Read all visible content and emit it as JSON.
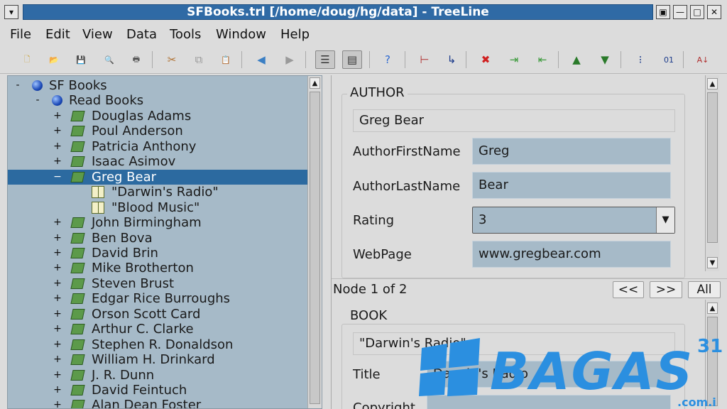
{
  "window": {
    "title": "SFBooks.trl [/home/doug/hg/data] - TreeLine",
    "controls": [
      "▣",
      "—",
      "□",
      "✕"
    ]
  },
  "menu": [
    "File",
    "Edit",
    "View",
    "Data",
    "Tools",
    "Window",
    "Help"
  ],
  "toolbar": [
    {
      "name": "new-file-icon",
      "glyph": "🗋",
      "color": "#caa23a"
    },
    {
      "name": "open-file-icon",
      "glyph": "📂",
      "color": "#3b7fc4"
    },
    {
      "name": "save-icon",
      "glyph": "💾",
      "color": "#8a8a8a"
    },
    {
      "name": "print-preview-icon",
      "glyph": "🔍",
      "color": "#3b7fc4"
    },
    {
      "name": "print-icon",
      "glyph": "🖶",
      "color": "#555"
    },
    {
      "name": "cut-icon",
      "glyph": "✂",
      "color": "#b07030"
    },
    {
      "name": "copy-icon",
      "glyph": "⧉",
      "color": "#999"
    },
    {
      "name": "paste-icon",
      "glyph": "📋",
      "color": "#c9a13a"
    },
    {
      "name": "back-icon",
      "glyph": "◀",
      "color": "#3b7fc4"
    },
    {
      "name": "forward-icon",
      "glyph": "▶",
      "color": "#9a9a9a"
    },
    {
      "name": "data-editor-view-icon",
      "glyph": "☰",
      "color": "#333"
    },
    {
      "name": "title-list-view-icon",
      "glyph": "▤",
      "color": "#333"
    },
    {
      "name": "help-icon",
      "glyph": "?",
      "color": "#2f6ad0"
    },
    {
      "name": "add-child-icon",
      "glyph": "⊢",
      "color": "#b03030"
    },
    {
      "name": "insert-after-icon",
      "glyph": "↳",
      "color": "#1b3a8a"
    },
    {
      "name": "delete-node-icon",
      "glyph": "✖",
      "color": "#d02020"
    },
    {
      "name": "indent-icon",
      "glyph": "⇥",
      "color": "#3a9a3a"
    },
    {
      "name": "unindent-icon",
      "glyph": "⇤",
      "color": "#3a9a3a"
    },
    {
      "name": "move-up-icon",
      "glyph": "▲",
      "color": "#2a7a2a"
    },
    {
      "name": "move-down-icon",
      "glyph": "▼",
      "color": "#2a7a2a"
    },
    {
      "name": "numbering-icon",
      "glyph": "⁝",
      "color": "#1b3a8a"
    },
    {
      "name": "binary-icon",
      "glyph": "01",
      "color": "#1b3a8a"
    },
    {
      "name": "sort-icon",
      "glyph": "A↓",
      "color": "#b03030"
    }
  ],
  "tree": [
    {
      "label": "SF Books",
      "indent": 0,
      "exp": "-",
      "icon": "ball"
    },
    {
      "label": "Read Books",
      "indent": 1,
      "exp": "-",
      "icon": "ball"
    },
    {
      "label": "Douglas Adams",
      "indent": 2,
      "exp": "+",
      "icon": "book"
    },
    {
      "label": "Poul Anderson",
      "indent": 2,
      "exp": "+",
      "icon": "book"
    },
    {
      "label": "Patricia Anthony",
      "indent": 2,
      "exp": "+",
      "icon": "book"
    },
    {
      "label": "Isaac Asimov",
      "indent": 2,
      "exp": "+",
      "icon": "book"
    },
    {
      "label": "Greg Bear",
      "indent": 2,
      "exp": "−",
      "icon": "book",
      "selected": true
    },
    {
      "label": "\"Darwin's Radio\"",
      "indent": 3,
      "exp": "",
      "icon": "openbook"
    },
    {
      "label": "\"Blood Music\"",
      "indent": 3,
      "exp": "",
      "icon": "openbook"
    },
    {
      "label": "John Birmingham",
      "indent": 2,
      "exp": "+",
      "icon": "book"
    },
    {
      "label": "Ben Bova",
      "indent": 2,
      "exp": "+",
      "icon": "book"
    },
    {
      "label": "David Brin",
      "indent": 2,
      "exp": "+",
      "icon": "book"
    },
    {
      "label": "Mike Brotherton",
      "indent": 2,
      "exp": "+",
      "icon": "book"
    },
    {
      "label": "Steven Brust",
      "indent": 2,
      "exp": "+",
      "icon": "book"
    },
    {
      "label": "Edgar Rice Burroughs",
      "indent": 2,
      "exp": "+",
      "icon": "book"
    },
    {
      "label": "Orson Scott Card",
      "indent": 2,
      "exp": "+",
      "icon": "book"
    },
    {
      "label": "Arthur C. Clarke",
      "indent": 2,
      "exp": "+",
      "icon": "book"
    },
    {
      "label": "Stephen R. Donaldson",
      "indent": 2,
      "exp": "+",
      "icon": "book"
    },
    {
      "label": "William H. Drinkard",
      "indent": 2,
      "exp": "+",
      "icon": "book"
    },
    {
      "label": "J. R. Dunn",
      "indent": 2,
      "exp": "+",
      "icon": "book"
    },
    {
      "label": "David Feintuch",
      "indent": 2,
      "exp": "+",
      "icon": "book"
    },
    {
      "label": "Alan Dean Foster",
      "indent": 2,
      "exp": "+",
      "icon": "book"
    }
  ],
  "author": {
    "group_title": "AUTHOR",
    "heading_value": "Greg Bear",
    "fields": [
      {
        "label": "AuthorFirstName",
        "value": "Greg"
      },
      {
        "label": "AuthorLastName",
        "value": "Bear"
      },
      {
        "label": "Rating",
        "value": "3"
      },
      {
        "label": "WebPage",
        "value": "www.gregbear.com"
      }
    ]
  },
  "nodebar": {
    "text": "Node 1 of 2",
    "prev": "<<",
    "next": ">>",
    "all": "All"
  },
  "book": {
    "group_title": "BOOK",
    "heading_value": "\"Darwin's Radio\"",
    "fields": [
      {
        "label": "Title",
        "value": "Darwin's Radio"
      },
      {
        "label": "Copyright",
        "value": ""
      }
    ]
  },
  "watermark": {
    "text": "BAGAS",
    "sup": "31",
    "domain": ".com.i"
  },
  "colors": {
    "title_bar": "#2f6aa5",
    "selection": "#2c6aa0",
    "field_bg": "#a6bac8",
    "watermark": "#2b8fe0"
  }
}
